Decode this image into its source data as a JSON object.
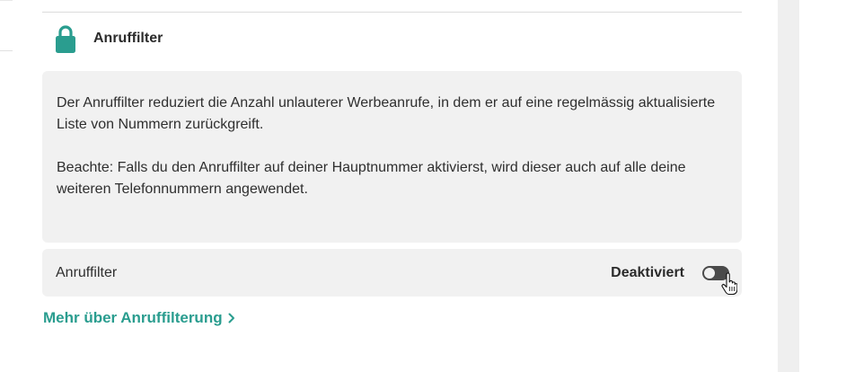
{
  "section": {
    "title": "Anruffilter",
    "icon": "lock-icon",
    "accent_color": "#2a9d8f"
  },
  "info": {
    "paragraph1": "Der Anruffilter reduziert die Anzahl unlauterer Werbeanrufe, in dem er auf eine regelmässig aktualisierte Liste von Nummern zurückgreift.",
    "paragraph2": "Beachte: Falls du den Anruffilter auf deiner Hauptnummer aktivierst, wird dieser auch auf alle deine weiteren Telefonnummern angewendet."
  },
  "setting": {
    "label": "Anruffilter",
    "status": "Deaktiviert",
    "enabled": false
  },
  "link": {
    "text": "Mehr über Anruffilterung",
    "icon": "chevron-right-icon"
  }
}
